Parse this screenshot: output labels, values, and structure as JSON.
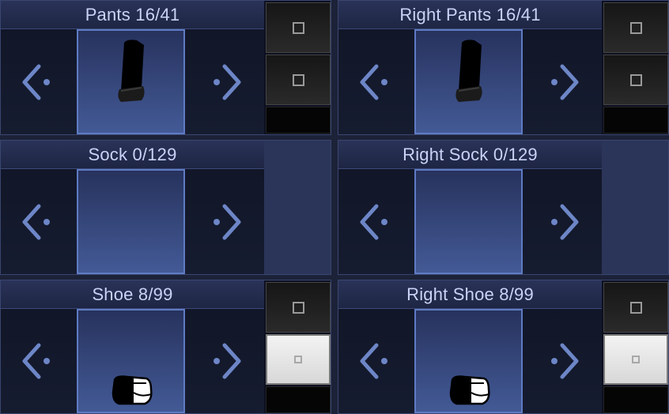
{
  "colors": {
    "arrow": "#6d86c7",
    "panel_bg": "#141a2b",
    "preview_top": "#27325d",
    "preview_bottom": "#435a96"
  },
  "panels": [
    {
      "id": "pants-left",
      "title": "Pants 16/41",
      "item": "pants-icon"
    },
    {
      "id": "pants-right",
      "title": "Right Pants 16/41",
      "item": "pants-icon"
    },
    {
      "id": "sock-left",
      "title": "Sock 0/129",
      "item": ""
    },
    {
      "id": "sock-right",
      "title": "Right Sock 0/129",
      "item": ""
    },
    {
      "id": "shoe-left",
      "title": "Shoe 8/99",
      "item": "shoe-icon"
    },
    {
      "id": "shoe-right",
      "title": "Right Shoe 8/99",
      "item": "shoe-icon"
    }
  ],
  "icons": {
    "prev": "arrow-left-icon",
    "next": "arrow-right-icon",
    "color_swatch": "square-icon"
  }
}
